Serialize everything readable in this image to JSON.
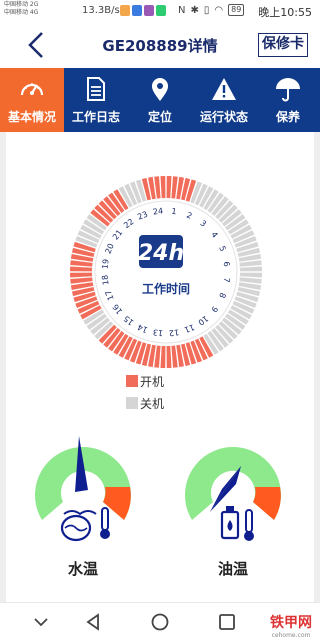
{
  "status_bar": {
    "carrier_line1": "中国移动 2G",
    "carrier_line2": "中国移动 4G",
    "net_speed": "13.3B/s",
    "battery": "89",
    "time": "晚上10:55"
  },
  "header": {
    "title": "GE208889详情",
    "card_button": "保修卡"
  },
  "tabs": [
    {
      "label": "基本情况",
      "icon": "dashboard-icon",
      "active": true
    },
    {
      "label": "工作日志",
      "icon": "document-icon",
      "active": false
    },
    {
      "label": "定位",
      "icon": "location-pin-icon",
      "active": false
    },
    {
      "label": "运行状态",
      "icon": "warning-icon",
      "active": false
    },
    {
      "label": "保养",
      "icon": "umbrella-icon",
      "active": false
    }
  ],
  "clock": {
    "badge": "24h",
    "caption": "工作时间",
    "hour_labels": [
      "1",
      "2",
      "3",
      "4",
      "5",
      "6",
      "7",
      "8",
      "9",
      "10",
      "11",
      "12",
      "13",
      "14",
      "15",
      "16",
      "17",
      "18",
      "19",
      "20",
      "21",
      "22",
      "23",
      "24"
    ],
    "on_color": "#f26c5a",
    "off_color": "#d5d5d5",
    "segments_on": [
      1,
      1,
      1,
      1,
      1,
      0,
      0,
      0,
      0,
      0,
      0,
      0,
      0,
      0,
      0,
      0,
      0,
      0,
      0,
      0,
      0,
      0,
      0,
      0,
      0,
      0,
      0,
      0,
      0,
      0,
      0,
      0,
      0,
      0,
      0,
      0,
      0,
      0,
      0,
      0,
      1,
      1,
      1,
      1,
      1,
      1,
      1,
      1,
      1,
      1,
      1,
      1,
      1,
      1,
      1,
      1,
      1,
      1,
      1,
      1,
      0,
      0,
      0,
      0,
      1,
      1,
      1,
      1,
      1,
      1,
      1,
      1,
      1,
      1,
      1,
      1,
      1,
      0,
      0,
      0,
      0,
      0,
      1,
      1,
      1,
      1,
      1,
      1,
      0,
      0,
      0,
      0,
      1,
      1,
      1,
      1
    ]
  },
  "legend": [
    {
      "label": "开机",
      "color": "#f26c5a"
    },
    {
      "label": "关机",
      "color": "#d5d5d5"
    }
  ],
  "gauges": [
    {
      "label": "水温",
      "icon": "water-temperature-icon",
      "needle_fraction": 0.38
    },
    {
      "label": "油温",
      "icon": "oil-temperature-icon",
      "needle_fraction": 0.62
    }
  ],
  "gauge_colors": {
    "normal": "#8ee88c",
    "high": "#ff5a1f",
    "needle": "#0f1f8f"
  },
  "watermark": {
    "main": "铁甲网",
    "sub": "cehome.com"
  }
}
